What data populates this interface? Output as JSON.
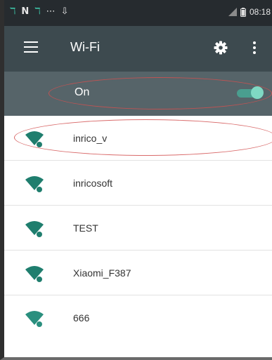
{
  "status_bar": {
    "time": "08:18",
    "left_icons": [
      "network-icon",
      "n-icon",
      "network-icon",
      "ellipsis-icon",
      "download-icon"
    ],
    "right_icons": [
      "signal-icon",
      "battery-icon"
    ]
  },
  "toolbar": {
    "title": "Wi-Fi",
    "background_color": "#3d4a4f"
  },
  "wifi_toggle": {
    "label": "On",
    "state": true,
    "accent_color": "#4a9e8f",
    "background_color": "#566469"
  },
  "networks": [
    {
      "name": "inrico_v",
      "icon": "wifi-signal-icon",
      "highlighted": true
    },
    {
      "name": "inricosoft",
      "icon": "wifi-signal-icon",
      "highlighted": false
    },
    {
      "name": "TEST",
      "icon": "wifi-signal-icon",
      "highlighted": false
    },
    {
      "name": "Xiaomi_F387",
      "icon": "wifi-signal-icon",
      "highlighted": false
    },
    {
      "name": "666",
      "icon": "wifi-signal-icon",
      "highlighted": false
    }
  ],
  "colors": {
    "wifi_icon": "#1f7e6e",
    "annotation": "#d25050"
  }
}
